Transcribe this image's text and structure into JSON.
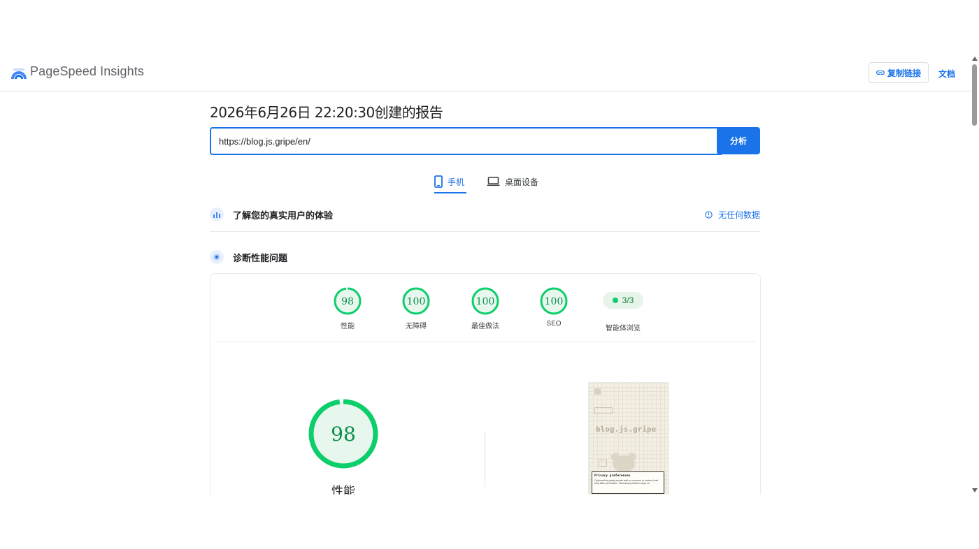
{
  "header": {
    "brand": "PageSpeed Insights",
    "copy_link_label": "复制链接",
    "docs_label": "文档"
  },
  "report": {
    "title": "2026年6月26日 22:20:30创建的报告",
    "url_value": "https://blog.js.gripe/en/",
    "analyze_label": "分析"
  },
  "tabs": [
    {
      "label": "手机",
      "active": true,
      "icon": "smartphone-icon"
    },
    {
      "label": "桌面设备",
      "active": false,
      "icon": "laptop-icon"
    }
  ],
  "field_section": {
    "title": "了解您的真实用户的体验",
    "status_label": "无任何数据",
    "icon": "crux-chart-icon"
  },
  "lab_section": {
    "title": "诊断性能问题",
    "icon": "lighthouse-icon"
  },
  "scores": [
    {
      "label": "性能",
      "value": "98",
      "fraction": 0.98
    },
    {
      "label": "无障碍",
      "value": "100",
      "fraction": 1.0
    },
    {
      "label": "最佳做法",
      "value": "100",
      "fraction": 1.0
    },
    {
      "label": "SEO",
      "value": "100",
      "fraction": 1.0
    }
  ],
  "agent_browsing": {
    "label": "智能体浏览",
    "value": "3/3"
  },
  "main_gauge": {
    "value": "98",
    "fraction": 0.98,
    "label": "性能"
  },
  "thumbnail": {
    "site_title": "blog.js.gripe",
    "popup_title": "Privacy preferences",
    "popup_text": "Optional first-party scripts wait on consent or metrics load only after permission. Necessary features stay on."
  },
  "colors": {
    "accent": "#1a73e8",
    "pass": "#0cce6b",
    "pass_fill": "#e8f7ee",
    "pass_text": "#0a8f4a"
  }
}
